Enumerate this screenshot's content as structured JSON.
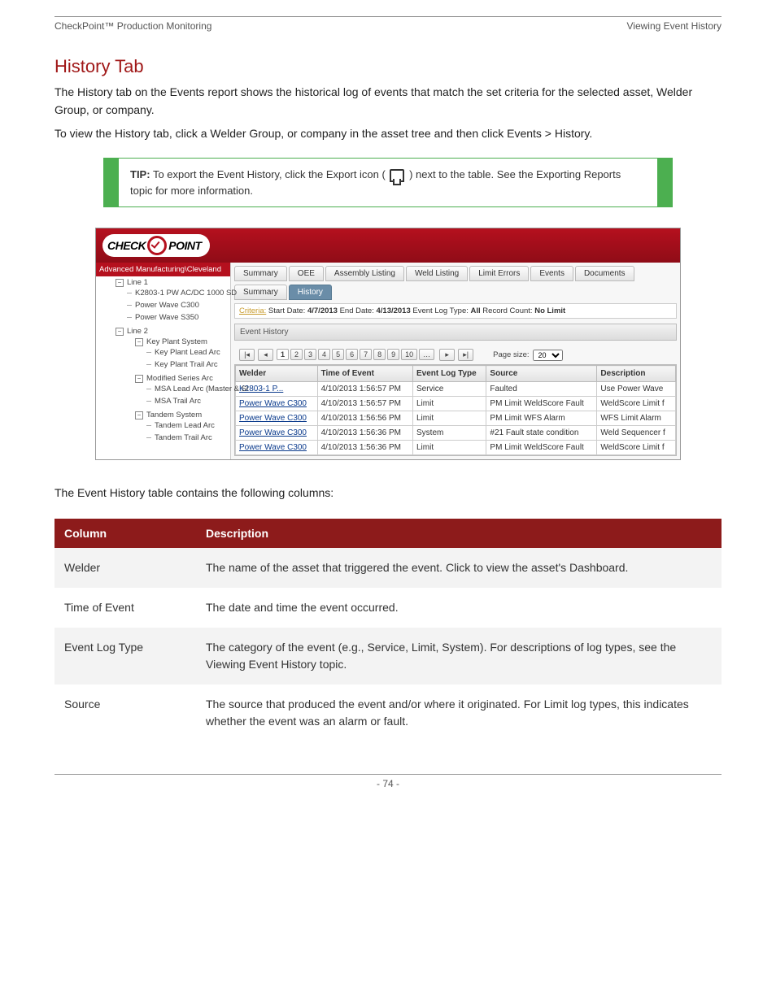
{
  "running": {
    "left": "CheckPoint™ Production Monitoring",
    "right": "Viewing Event History"
  },
  "title": "History Tab",
  "intro": [
    "The History tab on the Events report shows the historical log of events that match the set criteria for the selected asset, Welder Group, or company.",
    "To view the History tab, click a Welder Group, or company in the asset tree and then click Events > History."
  ],
  "tip": {
    "label": "TIP:",
    "lines": [
      "To export the Event History, click the Export icon (",
      ") next to the table. See the Exporting Reports topic for more information."
    ]
  },
  "shot": {
    "logo": {
      "a": "CHECK",
      "b": "POINT"
    },
    "tree_root": "Advanced Manufacturing\\Cleveland",
    "tree": [
      {
        "label": "Line 1",
        "folder": true,
        "children": [
          {
            "label": "K2803-1 PW AC/DC 1000 SD"
          },
          {
            "label": "Power Wave C300"
          },
          {
            "label": "Power Wave S350"
          }
        ]
      },
      {
        "label": "Line 2",
        "folder": true,
        "children": [
          {
            "label": "Key Plant System",
            "folder": true,
            "children": [
              {
                "label": "Key Plant Lead Arc"
              },
              {
                "label": "Key Plant Trail Arc"
              }
            ]
          },
          {
            "label": "Modified Series Arc",
            "folder": true,
            "children": [
              {
                "label": "MSA Lead Arc (Master & Sl"
              },
              {
                "label": "MSA Trail Arc"
              }
            ]
          },
          {
            "label": "Tandem System",
            "folder": true,
            "children": [
              {
                "label": "Tandem Lead Arc"
              },
              {
                "label": "Tandem Trail Arc"
              }
            ]
          }
        ]
      }
    ],
    "tabs": [
      "Summary",
      "OEE",
      "Assembly Listing",
      "Weld Listing",
      "Limit Errors",
      "Events",
      "Documents"
    ],
    "subtabs": [
      "Summary",
      "History"
    ],
    "subtab_active": 1,
    "criteria": {
      "label": "Criteria:",
      "text_a": " Start Date: ",
      "v1": "4/7/2013",
      "text_b": " End Date: ",
      "v2": "4/13/2013",
      "text_c": " Event Log Type: ",
      "v3": "All",
      "text_d": " Record Count: ",
      "v4": "No Limit"
    },
    "panel_header": "Event History",
    "pager": {
      "first": "|◂",
      "prev": "◂",
      "pages": [
        "1",
        "2",
        "3",
        "4",
        "5",
        "6",
        "7",
        "8",
        "9",
        "10",
        "…"
      ],
      "next": "▸",
      "last": "▸|",
      "size_label": "Page size:",
      "size": "20"
    },
    "columns": [
      "Welder",
      "Time of Event",
      "Event Log Type",
      "Source",
      "Description"
    ],
    "rows": [
      [
        "K2803-1 P...",
        "4/10/2013 1:56:57 PM",
        "Service",
        "Faulted",
        "Use Power Wave"
      ],
      [
        "Power Wave C300",
        "4/10/2013 1:56:57 PM",
        "Limit",
        "PM Limit WeldScore Fault",
        "WeldScore Limit f"
      ],
      [
        "Power Wave C300",
        "4/10/2013 1:56:56 PM",
        "Limit",
        "PM Limit WFS Alarm",
        "WFS Limit Alarm"
      ],
      [
        "Power Wave C300",
        "4/10/2013 1:56:36 PM",
        "System",
        "#21 Fault state condition",
        "Weld Sequencer f"
      ],
      [
        "Power Wave C300",
        "4/10/2013 1:56:36 PM",
        "Limit",
        "PM Limit WeldScore Fault",
        "WeldScore Limit f"
      ]
    ]
  },
  "cols_intro": "The Event History table contains the following columns:",
  "cols": {
    "headers": [
      "Column",
      "Description"
    ],
    "rows": [
      [
        "Welder",
        "The name of the asset that triggered the event. Click to view the asset's Dashboard."
      ],
      [
        "Time of Event",
        "The date and time the event occurred."
      ],
      [
        "Event Log Type",
        "The category of the event (e.g., Service, Limit, System). For descriptions of log types, see the Viewing Event History topic."
      ],
      [
        "Source",
        "The source that produced the event and/or where it originated. For Limit log types, this indicates whether the event was an alarm or fault."
      ]
    ]
  },
  "footer": {
    "left": "",
    "center": "- 74 -",
    "right": ""
  }
}
